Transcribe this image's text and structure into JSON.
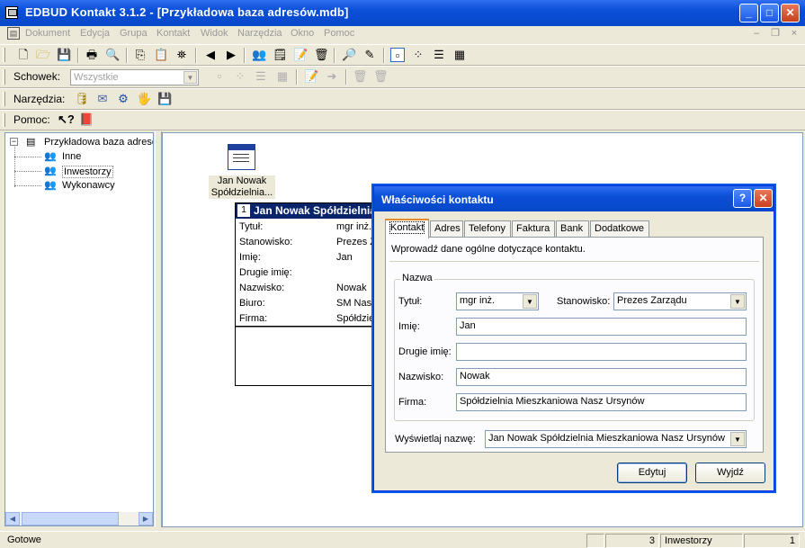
{
  "window": {
    "title": "EDBUD Kontakt 3.1.2 - [Przykładowa baza adresów.mdb]",
    "minimize": "_",
    "maximize": "□",
    "close": "✕"
  },
  "menu": [
    "Dokument",
    "Edycja",
    "Grupa",
    "Kontakt",
    "Widok",
    "Narzędzia",
    "Okno",
    "Pomoc"
  ],
  "mdi_controls": [
    "–",
    "❐",
    "×"
  ],
  "toolbars": {
    "clipboard_label": "Schowek:",
    "clipboard_value": "Wszystkie",
    "tools_label": "Narzędzia:",
    "help_label": "Pomoc:"
  },
  "tree": {
    "root": "Przykładowa baza adresów",
    "items": [
      "Inne",
      "Inwestorzy",
      "Wykonawcy"
    ]
  },
  "canvas": {
    "icon_label_line1": "Jan Nowak",
    "icon_label_line2": "Spółdzielnia...",
    "card": {
      "number": "1",
      "header": "Jan Nowak Spółdzielnia",
      "rows": [
        {
          "label": "Tytuł:",
          "value": "mgr inż."
        },
        {
          "label": "Stanowisko:",
          "value": "Prezes Z"
        },
        {
          "label": "Imię:",
          "value": "Jan"
        },
        {
          "label": "Drugie imię:",
          "value": ""
        },
        {
          "label": "Nazwisko:",
          "value": "Nowak"
        },
        {
          "label": "Biuro:",
          "value": "SM Nasz"
        },
        {
          "label": "Firma:",
          "value": "Spółdzie"
        }
      ]
    }
  },
  "dialog": {
    "title": "Właściwości kontaktu",
    "help": "?",
    "close": "✕",
    "tabs": [
      "Kontakt",
      "Adres",
      "Telefony",
      "Faktura",
      "Bank",
      "Dodatkowe"
    ],
    "description": "Wprowadź dane ogólne dotyczące kontaktu.",
    "group_label": "Nazwa",
    "fields": {
      "title_label": "Tytuł:",
      "title_value": "mgr inż.",
      "position_label": "Stanowisko:",
      "position_value": "Prezes Zarządu",
      "first_name_label": "Imię:",
      "first_name_value": "Jan",
      "middle_name_label": "Drugie imię:",
      "middle_name_value": "",
      "last_name_label": "Nazwisko:",
      "last_name_value": "Nowak",
      "company_label": "Firma:",
      "company_value": "Spółdzielnia Mieszkaniowa  Nasz Ursynów"
    },
    "display_name_label": "Wyświetlaj nazwę:",
    "display_name_value": "Jan Nowak Spółdzielnia Mieszkaniowa  Nasz Ursynów",
    "edit_button": "Edytuj",
    "exit_button": "Wyjdź"
  },
  "status": {
    "text": "Gotowe",
    "count": "3",
    "group": "Inwestorzy",
    "page": "1"
  }
}
